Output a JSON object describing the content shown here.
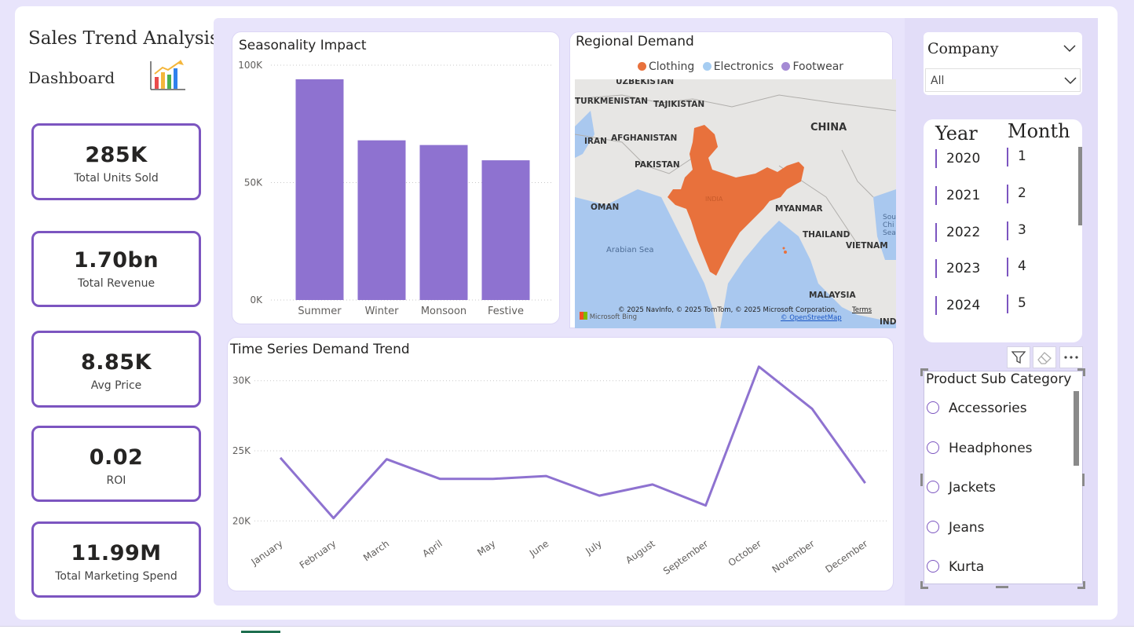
{
  "dashboard": {
    "title_line1": "Sales Trend Analysis",
    "title_line2": "Dashboard",
    "icon": "bar-chart-icon"
  },
  "kpis": [
    {
      "value": "285K",
      "label": "Total Units Sold"
    },
    {
      "value": "1.70bn",
      "label": "Total Revenue"
    },
    {
      "value": "8.85K",
      "label": "Avg Price"
    },
    {
      "value": "0.02",
      "label": "ROI"
    },
    {
      "value": "11.99M",
      "label": "Total Marketing Spend"
    }
  ],
  "seasonality": {
    "title": "Seasonality Impact"
  },
  "timeseries": {
    "title": "Time Series Demand Trend"
  },
  "regional": {
    "title": "Regional Demand",
    "legend": [
      {
        "label": "Clothing",
        "color": "#e8713c"
      },
      {
        "label": "Electronics",
        "color": "#a6cdf2"
      },
      {
        "label": "Footwear",
        "color": "#a48ad4"
      }
    ],
    "map_labels": [
      "UZBEKISTAN",
      "TURKMENISTAN",
      "TAJIKISTAN",
      "CHINA",
      "IRAN",
      "AFGHANISTAN",
      "PAKISTAN",
      "INDIA",
      "OMAN",
      "MYANMAR",
      "Arabian Sea",
      "THAILAND",
      "VIETNAM",
      "MALAYSIA",
      "Sou Chi Sea",
      "INDO"
    ],
    "attribution": "© 2025 NavInfo, © 2025 TomTom, © 2025 Microsoft Corporation,",
    "terms": "Terms",
    "osm": "© OpenStreetMap",
    "bing": "Microsoft Bing"
  },
  "colors": {
    "accent": "#7c55c0",
    "bar": "#8e72d0",
    "line": "#8e72d0",
    "india": "#e8713c",
    "water": "#a9c8ef"
  },
  "company_slicer": {
    "label": "Company",
    "selected": "All"
  },
  "year_month_slicer": {
    "year_label": "Year",
    "month_label": "Month",
    "years": [
      "2020",
      "2021",
      "2022",
      "2023",
      "2024"
    ],
    "months": [
      "1",
      "2",
      "3",
      "4",
      "5"
    ]
  },
  "subcategory_slicer": {
    "label": "Product Sub Category",
    "items": [
      "Accessories",
      "Headphones",
      "Jackets",
      "Jeans",
      "Kurta"
    ]
  },
  "chart_data": [
    {
      "type": "bar",
      "title": "Seasonality Impact",
      "categories": [
        "Summer",
        "Winter",
        "Monsoon",
        "Festive"
      ],
      "values": [
        94000,
        68000,
        66000,
        59500
      ],
      "ylim": [
        0,
        100000
      ],
      "yticks": [
        0,
        50000,
        100000
      ],
      "ytick_labels": [
        "0K",
        "50K",
        "100K"
      ],
      "grid": true
    },
    {
      "type": "line",
      "title": "Time Series Demand Trend",
      "categories": [
        "January",
        "February",
        "March",
        "April",
        "May",
        "June",
        "July",
        "August",
        "September",
        "October",
        "November",
        "December"
      ],
      "values": [
        24500,
        20200,
        24400,
        23000,
        23000,
        23200,
        21800,
        22600,
        21100,
        31000,
        28000,
        22700
      ],
      "ylim": [
        18000,
        32000
      ],
      "yticks": [
        20000,
        25000,
        30000
      ],
      "ytick_labels": [
        "20K",
        "25K",
        "30K"
      ],
      "grid": true
    }
  ]
}
